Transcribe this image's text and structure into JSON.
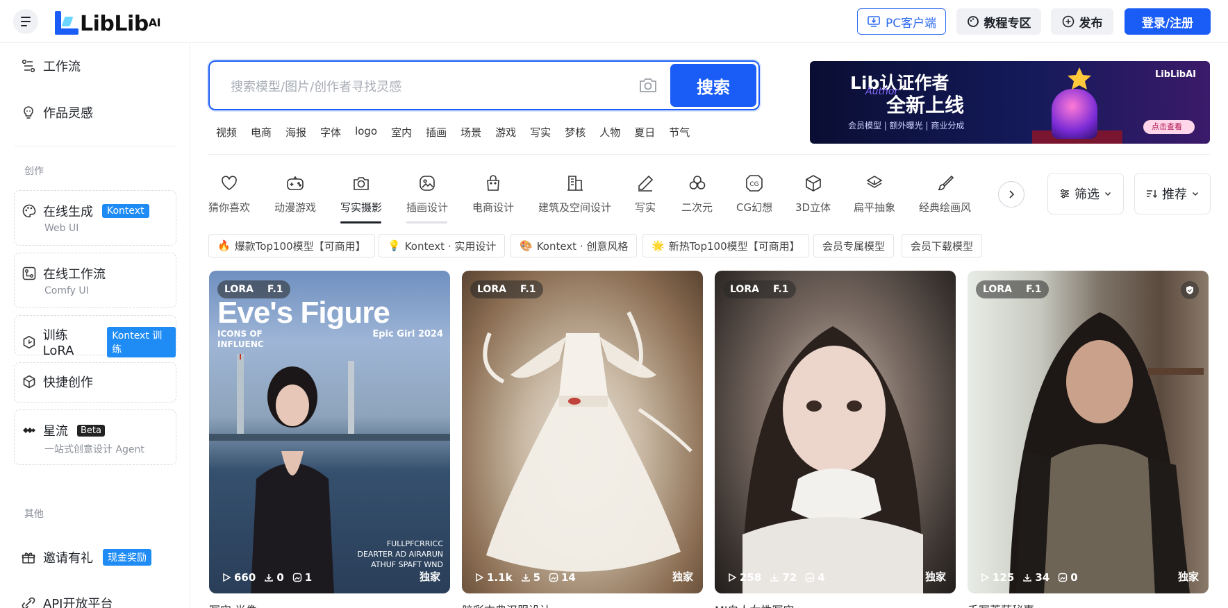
{
  "header": {
    "logo_text": "LibLib",
    "logo_sup": "AI",
    "pc_client": "PC客户端",
    "tutorial": "教程专区",
    "publish": "发布",
    "login": "登录/注册"
  },
  "sidebar": {
    "top_items": [
      {
        "label": "工作流"
      },
      {
        "label": "作品灵感"
      }
    ],
    "section_create": "创作",
    "cards": [
      {
        "label": "在线生成",
        "badge": "Kontext",
        "sub": "Web UI"
      },
      {
        "label": "在线工作流",
        "sub": "Comfy UI"
      },
      {
        "label": "训练LoRA",
        "badge": "Kontext 训练"
      },
      {
        "label": "快捷创作"
      },
      {
        "label": "星流",
        "badge": "Beta",
        "sub": "一站式创意设计 Agent"
      }
    ],
    "section_other": "其他",
    "other_items": [
      {
        "label": "邀请有礼",
        "badge": "现金奖励"
      },
      {
        "label": "API开放平台"
      }
    ]
  },
  "search": {
    "placeholder": "搜索模型/图片/创作者寻找灵感",
    "button": "搜索",
    "tags": [
      "视频",
      "电商",
      "海报",
      "字体",
      "logo",
      "室内",
      "插画",
      "场景",
      "游戏",
      "写实",
      "梦核",
      "人物",
      "夏日",
      "节气"
    ]
  },
  "banner": {
    "line1": "Lib认证作者",
    "author": "Author",
    "line2": "全新上线",
    "sub": "会员模型 | 额外曝光 | 商业分成",
    "logo": "LibLibAI",
    "btn": "点击查看"
  },
  "categories": [
    {
      "label": "猜你喜欢",
      "icon": "heart-icon"
    },
    {
      "label": "动漫游戏",
      "icon": "gamepad-icon"
    },
    {
      "label": "写实摄影",
      "icon": "camera-icon",
      "active": true
    },
    {
      "label": "插画设计",
      "icon": "image-icon"
    },
    {
      "label": "电商设计",
      "icon": "bag-icon"
    },
    {
      "label": "建筑及空间设计",
      "icon": "building-icon"
    },
    {
      "label": "写实",
      "icon": "pencil-icon"
    },
    {
      "label": "二次元",
      "icon": "clover-icon"
    },
    {
      "label": "CG幻想",
      "icon": "cg-icon"
    },
    {
      "label": "3D立体",
      "icon": "cube-icon"
    },
    {
      "label": "扁平抽象",
      "icon": "layers-icon"
    },
    {
      "label": "经典绘画风",
      "icon": "brush-icon"
    }
  ],
  "filter": {
    "label": "筛选"
  },
  "sort": {
    "label": "推荐"
  },
  "chips": [
    {
      "icon": "🔥",
      "label": "爆款Top100模型【可商用】"
    },
    {
      "icon": "💡",
      "label": "Kontext · 实用设计"
    },
    {
      "icon": "🎨",
      "label": "Kontext · 创意风格"
    },
    {
      "icon": "🌟",
      "label": "新热Top100模型【可商用】"
    },
    {
      "icon": "",
      "label": "会员专属模型"
    },
    {
      "icon": "",
      "label": "会员下载模型"
    }
  ],
  "cards": [
    {
      "type": "LORA",
      "base": "F.1",
      "runs": "660",
      "downloads": "0",
      "images": "1",
      "exclusive": "独家",
      "cover_title": "Eve's Figure",
      "cover_sub1": "ICONS OF",
      "cover_sub2": "INFLUENC",
      "cover_sub3": "Epic Girl 2024",
      "cover_bottom1": "FULLPFCRRICC",
      "cover_bottom2": "DEARTER AD AIRARUN",
      "cover_bottom3": "ATHUF SPAFT WND",
      "peek": "写实·肖像"
    },
    {
      "type": "LORA",
      "base": "F.1",
      "runs": "1.1k",
      "downloads": "5",
      "images": "14",
      "exclusive": "独家",
      "peek": "胶彩古典汉服设计"
    },
    {
      "type": "LORA",
      "base": "F.1",
      "runs": "258",
      "downloads": "72",
      "images": "4",
      "exclusive": "独家",
      "peek": "MJ白人女性写实"
    },
    {
      "type": "LORA",
      "base": "F.1",
      "runs": "125",
      "downloads": "34",
      "images": "0",
      "exclusive": "独家",
      "peek": "手写菩萨秘事"
    }
  ],
  "colors": {
    "accent": "#1a5cf6",
    "badge": "#1f8cf5"
  }
}
